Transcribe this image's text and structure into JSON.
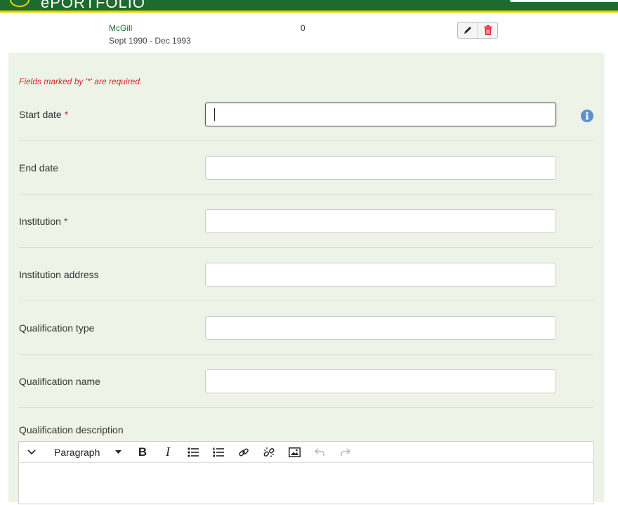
{
  "header": {
    "title": "ePORTFOLIO"
  },
  "existing_entry": {
    "institution": "McGill",
    "dates": "Sept 1990 - Dec 1993",
    "count": "0"
  },
  "form": {
    "required_note": "Fields marked by '*' are required.",
    "fields": [
      {
        "label": "Start date",
        "required": true,
        "value": ""
      },
      {
        "label": "End date",
        "required": false,
        "value": ""
      },
      {
        "label": "Institution",
        "required": true,
        "value": ""
      },
      {
        "label": "Institution address",
        "required": false,
        "value": ""
      },
      {
        "label": "Qualification type",
        "required": false,
        "value": ""
      },
      {
        "label": "Qualification name",
        "required": false,
        "value": ""
      }
    ],
    "required_marker": "*",
    "description_label": "Qualification description"
  },
  "editor": {
    "format_select": "Paragraph",
    "tools": [
      "bold-icon",
      "italic-icon",
      "bullet-list-icon",
      "numbered-list-icon",
      "link-icon",
      "unlink-icon",
      "image-icon",
      "undo-icon",
      "redo-icon"
    ]
  },
  "colors": {
    "header_green": "#1e6b2f",
    "header_yellow": "#e4d400",
    "panel_background": "#eef3e8",
    "required_red": "#d9232a",
    "info_blue": "#5b8fd0"
  }
}
